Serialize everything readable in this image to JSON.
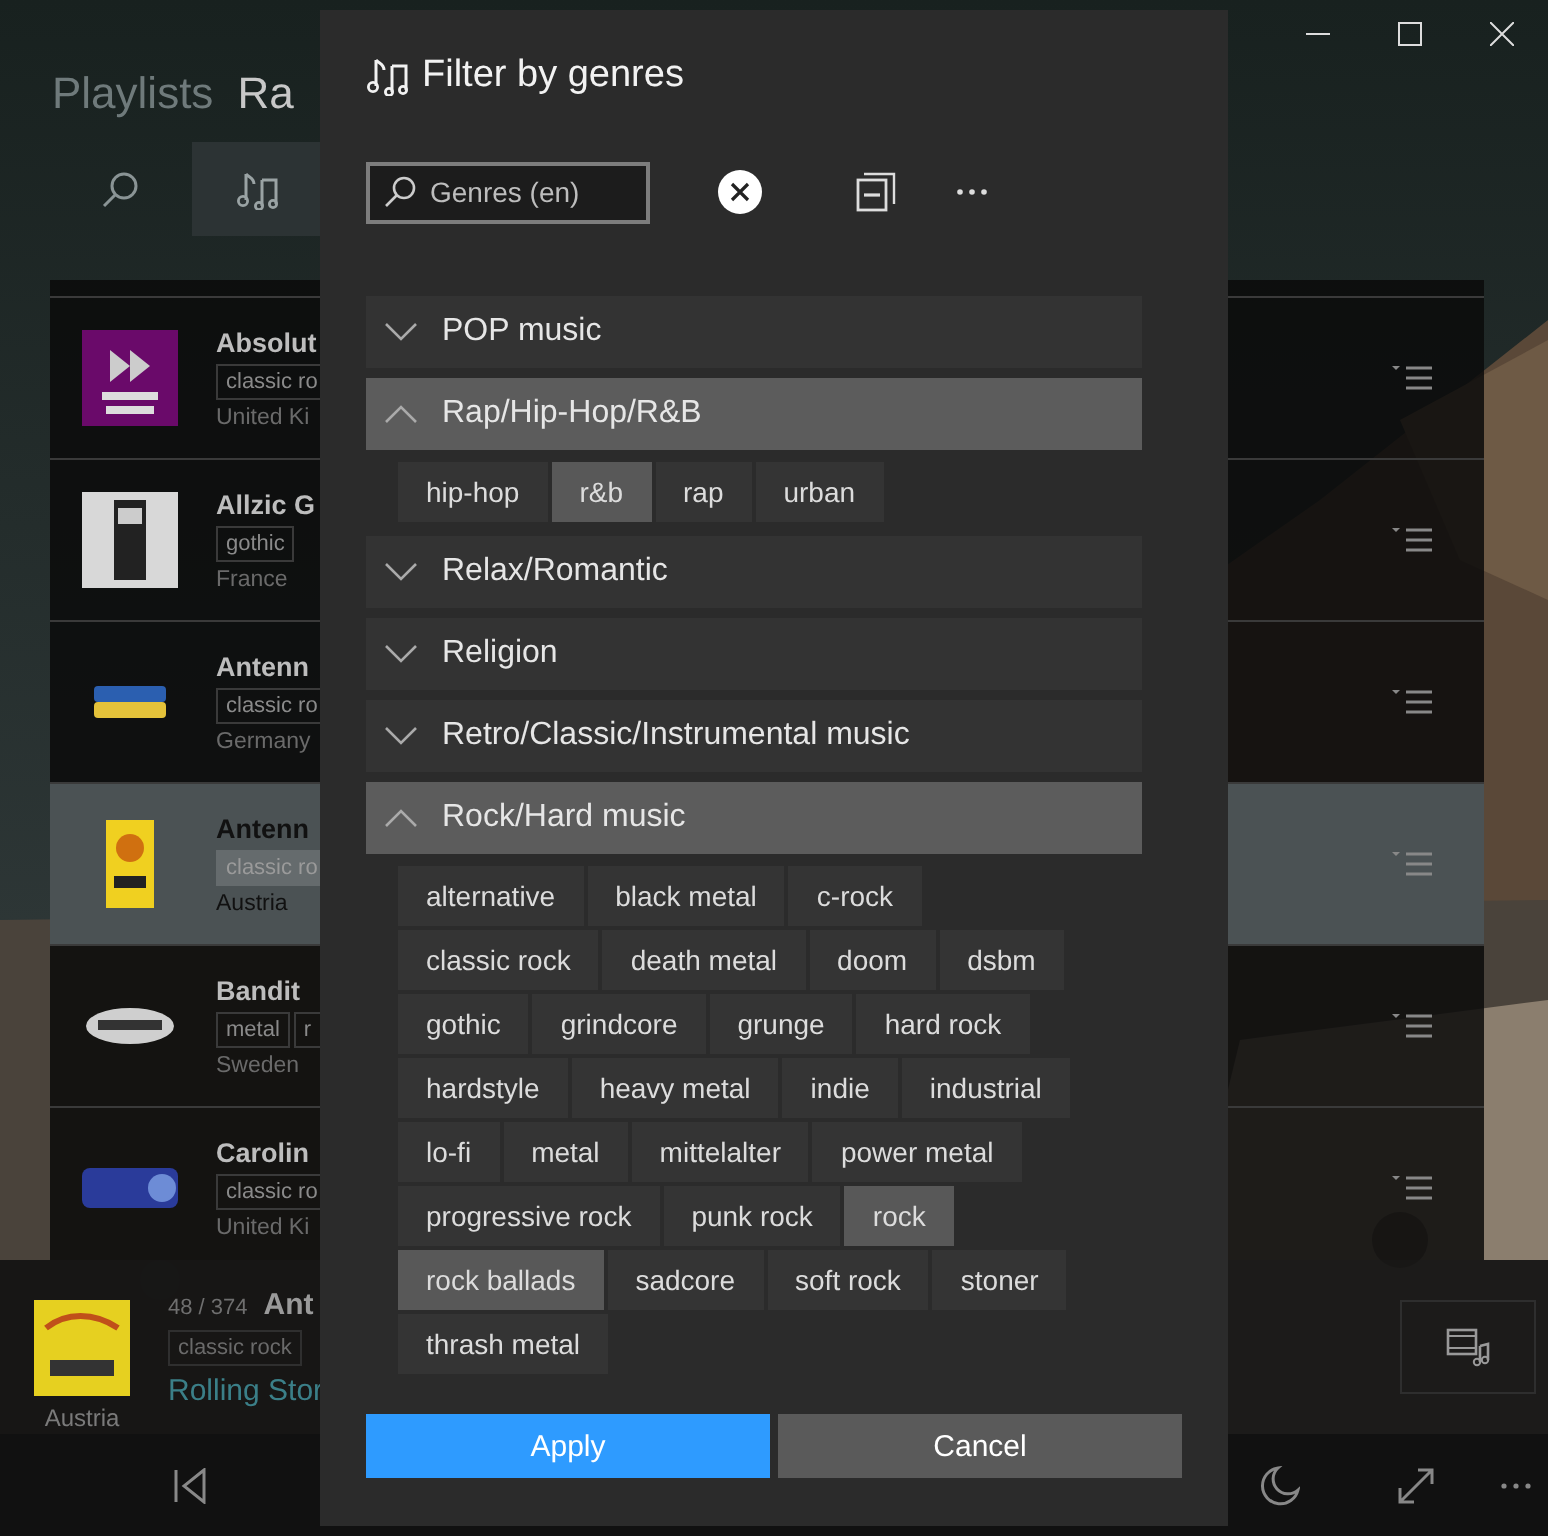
{
  "header": {
    "tabs": [
      {
        "label": "Playlists",
        "selected": false
      },
      {
        "label": "Ra",
        "selected": true
      }
    ]
  },
  "toolbar": [
    {
      "kind": "search",
      "selected": false
    },
    {
      "kind": "genres",
      "selected": true
    }
  ],
  "stations": [
    {
      "name": "Absolut",
      "tags": [
        "classic ro"
      ],
      "country": "United Ki",
      "selected": false
    },
    {
      "name": "Allzic G",
      "tags": [
        "gothic"
      ],
      "country": "France",
      "selected": false
    },
    {
      "name": "Antenn",
      "tags": [
        "classic ro"
      ],
      "country": "Germany",
      "selected": false
    },
    {
      "name": "Antenn",
      "tags": [
        "classic ro"
      ],
      "country": "Austria",
      "selected": true
    },
    {
      "name": "Bandit",
      "tags": [
        "metal",
        "r"
      ],
      "country": "Sweden",
      "selected": false
    },
    {
      "name": "Carolin",
      "tags": [
        "classic ro"
      ],
      "country": "United Ki",
      "selected": false
    }
  ],
  "now_playing": {
    "position": "48 / 374",
    "title": "Ant",
    "tags": [
      "classic rock"
    ],
    "country": "Austria",
    "track": "Rolling Stor"
  },
  "dialog": {
    "title": "Filter by genres",
    "search": {
      "placeholder": "Genres (en)"
    },
    "groups": [
      {
        "label": "POP music",
        "expanded": false
      },
      {
        "label": "Rap/Hip-Hop/R&B",
        "expanded": true,
        "genres": [
          {
            "label": "hip-hop",
            "selected": false
          },
          {
            "label": "r&b",
            "selected": true
          },
          {
            "label": "rap",
            "selected": false
          },
          {
            "label": "urban",
            "selected": false
          }
        ]
      },
      {
        "label": "Relax/Romantic",
        "expanded": false
      },
      {
        "label": "Religion",
        "expanded": false
      },
      {
        "label": "Retro/Classic/Instrumental music",
        "expanded": false
      },
      {
        "label": "Rock/Hard music",
        "expanded": true,
        "genres": [
          {
            "label": "alternative",
            "selected": false
          },
          {
            "label": "black metal",
            "selected": false
          },
          {
            "label": "c-rock",
            "selected": false
          },
          {
            "label": "classic rock",
            "selected": false
          },
          {
            "label": "death metal",
            "selected": false
          },
          {
            "label": "doom",
            "selected": false
          },
          {
            "label": "dsbm",
            "selected": false
          },
          {
            "label": "gothic",
            "selected": false
          },
          {
            "label": "grindcore",
            "selected": false
          },
          {
            "label": "grunge",
            "selected": false
          },
          {
            "label": "hard rock",
            "selected": false
          },
          {
            "label": "hardstyle",
            "selected": false
          },
          {
            "label": "heavy metal",
            "selected": false
          },
          {
            "label": "indie",
            "selected": false
          },
          {
            "label": "industrial",
            "selected": false
          },
          {
            "label": "lo-fi",
            "selected": false
          },
          {
            "label": "metal",
            "selected": false
          },
          {
            "label": "mittelalter",
            "selected": false
          },
          {
            "label": "power metal",
            "selected": false
          },
          {
            "label": "progressive rock",
            "selected": false
          },
          {
            "label": "punk rock",
            "selected": false
          },
          {
            "label": "rock",
            "selected": true
          },
          {
            "label": "rock ballads",
            "selected": true
          },
          {
            "label": "sadcore",
            "selected": false
          },
          {
            "label": "soft rock",
            "selected": false
          },
          {
            "label": "stoner",
            "selected": false
          },
          {
            "label": "thrash metal",
            "selected": false
          }
        ]
      }
    ],
    "buttons": [
      {
        "label": "Apply",
        "kind": "primary"
      },
      {
        "label": "Cancel",
        "kind": "secondary"
      }
    ]
  }
}
